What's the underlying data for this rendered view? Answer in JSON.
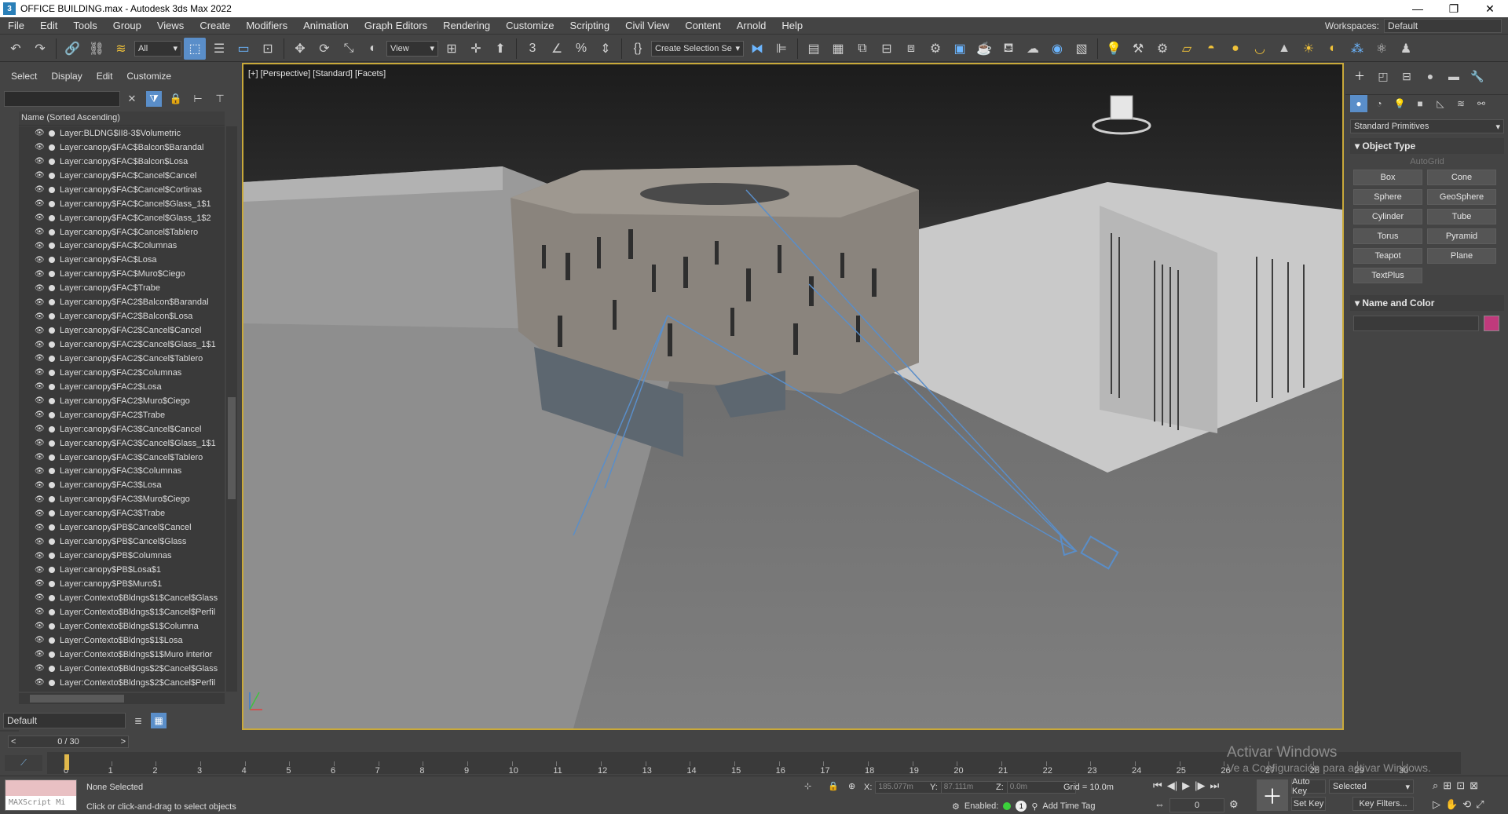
{
  "titlebar": {
    "title": "OFFICE BUILDING.max - Autodesk 3ds Max 2022",
    "minimize": "—",
    "maximize": "❐",
    "close": "✕"
  },
  "menu": [
    "File",
    "Edit",
    "Tools",
    "Group",
    "Views",
    "Create",
    "Modifiers",
    "Animation",
    "Graph Editors",
    "Rendering",
    "Customize",
    "Scripting",
    "Civil View",
    "Content",
    "Arnold",
    "Help"
  ],
  "workspace": {
    "label": "Workspaces:",
    "value": "Default"
  },
  "toolbar": {
    "filter": "All",
    "view": "View",
    "selection_set": "Create Selection Se"
  },
  "scene_explorer": {
    "tabs": [
      "Select",
      "Display",
      "Edit",
      "Customize"
    ],
    "column": "Name (Sorted Ascending)",
    "items": [
      "Layer:BLDNG$II8-3$Volumetric",
      "Layer:canopy$FAC$Balcon$Barandal",
      "Layer:canopy$FAC$Balcon$Losa",
      "Layer:canopy$FAC$Cancel$Cancel",
      "Layer:canopy$FAC$Cancel$Cortinas",
      "Layer:canopy$FAC$Cancel$Glass_1$1",
      "Layer:canopy$FAC$Cancel$Glass_1$2",
      "Layer:canopy$FAC$Cancel$Tablero",
      "Layer:canopy$FAC$Columnas",
      "Layer:canopy$FAC$Losa",
      "Layer:canopy$FAC$Muro$Ciego",
      "Layer:canopy$FAC$Trabe",
      "Layer:canopy$FAC2$Balcon$Barandal",
      "Layer:canopy$FAC2$Balcon$Losa",
      "Layer:canopy$FAC2$Cancel$Cancel",
      "Layer:canopy$FAC2$Cancel$Glass_1$1",
      "Layer:canopy$FAC2$Cancel$Tablero",
      "Layer:canopy$FAC2$Columnas",
      "Layer:canopy$FAC2$Losa",
      "Layer:canopy$FAC2$Muro$Ciego",
      "Layer:canopy$FAC2$Trabe",
      "Layer:canopy$FAC3$Cancel$Cancel",
      "Layer:canopy$FAC3$Cancel$Glass_1$1",
      "Layer:canopy$FAC3$Cancel$Tablero",
      "Layer:canopy$FAC3$Columnas",
      "Layer:canopy$FAC3$Losa",
      "Layer:canopy$FAC3$Muro$Ciego",
      "Layer:canopy$FAC3$Trabe",
      "Layer:canopy$PB$Cancel$Cancel",
      "Layer:canopy$PB$Cancel$Glass",
      "Layer:canopy$PB$Columnas",
      "Layer:canopy$PB$Losa$1",
      "Layer:canopy$PB$Muro$1",
      "Layer:Contexto$Bldngs$1$Cancel$Glass",
      "Layer:Contexto$Bldngs$1$Cancel$Perfil",
      "Layer:Contexto$Bldngs$1$Columna",
      "Layer:Contexto$Bldngs$1$Losa",
      "Layer:Contexto$Bldngs$1$Muro interior",
      "Layer:Contexto$Bldngs$2$Cancel$Glass",
      "Layer:Contexto$Bldngs$2$Cancel$Perfil"
    ],
    "layer": "Default"
  },
  "viewport": {
    "label": "[+] [Perspective] [Standard] [Facets]"
  },
  "command_panel": {
    "dropdown": "Standard Primitives",
    "object_type_title": "Object Type",
    "autogrid": "AutoGrid",
    "buttons": [
      "Box",
      "Cone",
      "Sphere",
      "GeoSphere",
      "Cylinder",
      "Tube",
      "Torus",
      "Pyramid",
      "Teapot",
      "Plane",
      "TextPlus"
    ],
    "name_color_title": "Name and Color",
    "swatch_color": "#c03a7c"
  },
  "frame": {
    "counter": "0 / 30",
    "prev": "<",
    "next": ">"
  },
  "timeline": {
    "ticks": [
      "0",
      "1",
      "2",
      "3",
      "4",
      "5",
      "6",
      "7",
      "8",
      "9",
      "10",
      "11",
      "12",
      "13",
      "14",
      "15",
      "16",
      "17",
      "18",
      "19",
      "20",
      "21",
      "22",
      "23",
      "24",
      "25",
      "26",
      "27",
      "28",
      "29",
      "30"
    ]
  },
  "watermark": {
    "line1": "Activar Windows",
    "line2": "Ve a Configuración para activar Windows."
  },
  "status": {
    "maxscript": "MAXScript Mi",
    "selection": "None Selected",
    "prompt": "Click or click-and-drag to select objects",
    "x_label": "X:",
    "x": "185.077m",
    "y_label": "Y:",
    "y": "87.111m",
    "z_label": "Z:",
    "z": "0.0m",
    "grid": "Grid = 10.0m",
    "enabled": "Enabled:",
    "add_time_tag": "Add Time Tag",
    "auto_key": "Auto Key",
    "set_key": "Set Key",
    "key_mode": "Selected",
    "key_filters": "Key Filters...",
    "frame_value": "0"
  }
}
